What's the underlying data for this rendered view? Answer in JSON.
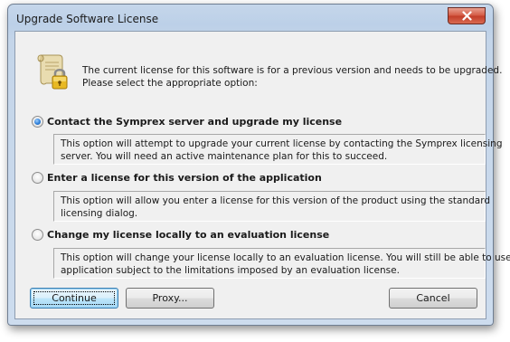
{
  "window": {
    "title": "Upgrade Software License"
  },
  "header": {
    "line1": "The current license for this software is for a previous version and needs to be upgraded.",
    "line2": "Please select the appropriate option:",
    "icon": "license-scroll-lock-icon"
  },
  "options": [
    {
      "label": "Contact the Symprex server and upgrade my license",
      "selected": true,
      "desc1": "This option will attempt to upgrade your current license by contacting the Symprex licensing",
      "desc2": "server. You will need an active maintenance plan for this to succeed."
    },
    {
      "label": "Enter a license for this version of the application",
      "selected": false,
      "desc1": "This option will allow you enter a license for this version of the product using the standard",
      "desc2": "licensing dialog."
    },
    {
      "label": "Change my license locally to an evaluation license",
      "selected": false,
      "desc1": "This option will change your license locally to an evaluation license. You will still be able to use this",
      "desc2": "application subject to the limitations imposed by an evaluation license."
    }
  ],
  "buttons": {
    "continue": "Continue",
    "proxy": "Proxy...",
    "cancel": "Cancel"
  },
  "colors": {
    "frame": "#c4d5e9",
    "client": "#f0f0f0",
    "close": "#c23c28",
    "default_button": "#a7d9f5"
  }
}
